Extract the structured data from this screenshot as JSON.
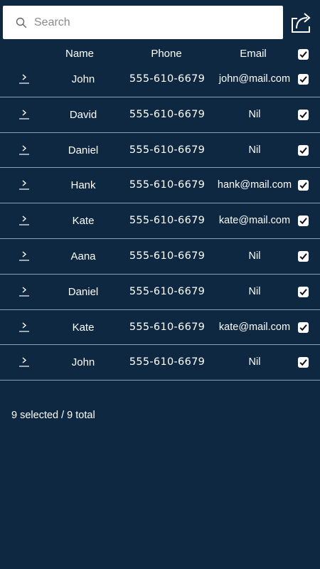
{
  "search": {
    "placeholder": "Search",
    "value": ""
  },
  "toolbar": {
    "share_icon": "share-icon"
  },
  "table": {
    "columns": [
      "Name",
      "Phone",
      "Email"
    ],
    "rows": [
      {
        "name": "John",
        "phone": "555-610-6679",
        "email": "john@mail.com",
        "checked": true
      },
      {
        "name": "David",
        "phone": "555-610-6679",
        "email": "Nil",
        "checked": true
      },
      {
        "name": "Daniel",
        "phone": "555-610-6679",
        "email": "Nil",
        "checked": true
      },
      {
        "name": "Hank",
        "phone": "555-610-6679",
        "email": "hank@mail.com",
        "checked": true
      },
      {
        "name": "Kate",
        "phone": "555-610-6679",
        "email": "kate@mail.com",
        "checked": true
      },
      {
        "name": "Aana",
        "phone": "555-610-6679",
        "email": "Nil",
        "checked": true
      },
      {
        "name": "Daniel",
        "phone": "555-610-6679",
        "email": "Nil",
        "checked": true
      },
      {
        "name": "Kate",
        "phone": "555-610-6679",
        "email": "kate@mail.com",
        "checked": true
      },
      {
        "name": "John",
        "phone": "555-610-6679",
        "email": "Nil",
        "checked": true
      }
    ]
  },
  "status": {
    "selection": "9 selected / 9 total"
  },
  "colors": {
    "background": "#0d2840",
    "divider": "#8ea0b3",
    "text": "#ffffff"
  }
}
